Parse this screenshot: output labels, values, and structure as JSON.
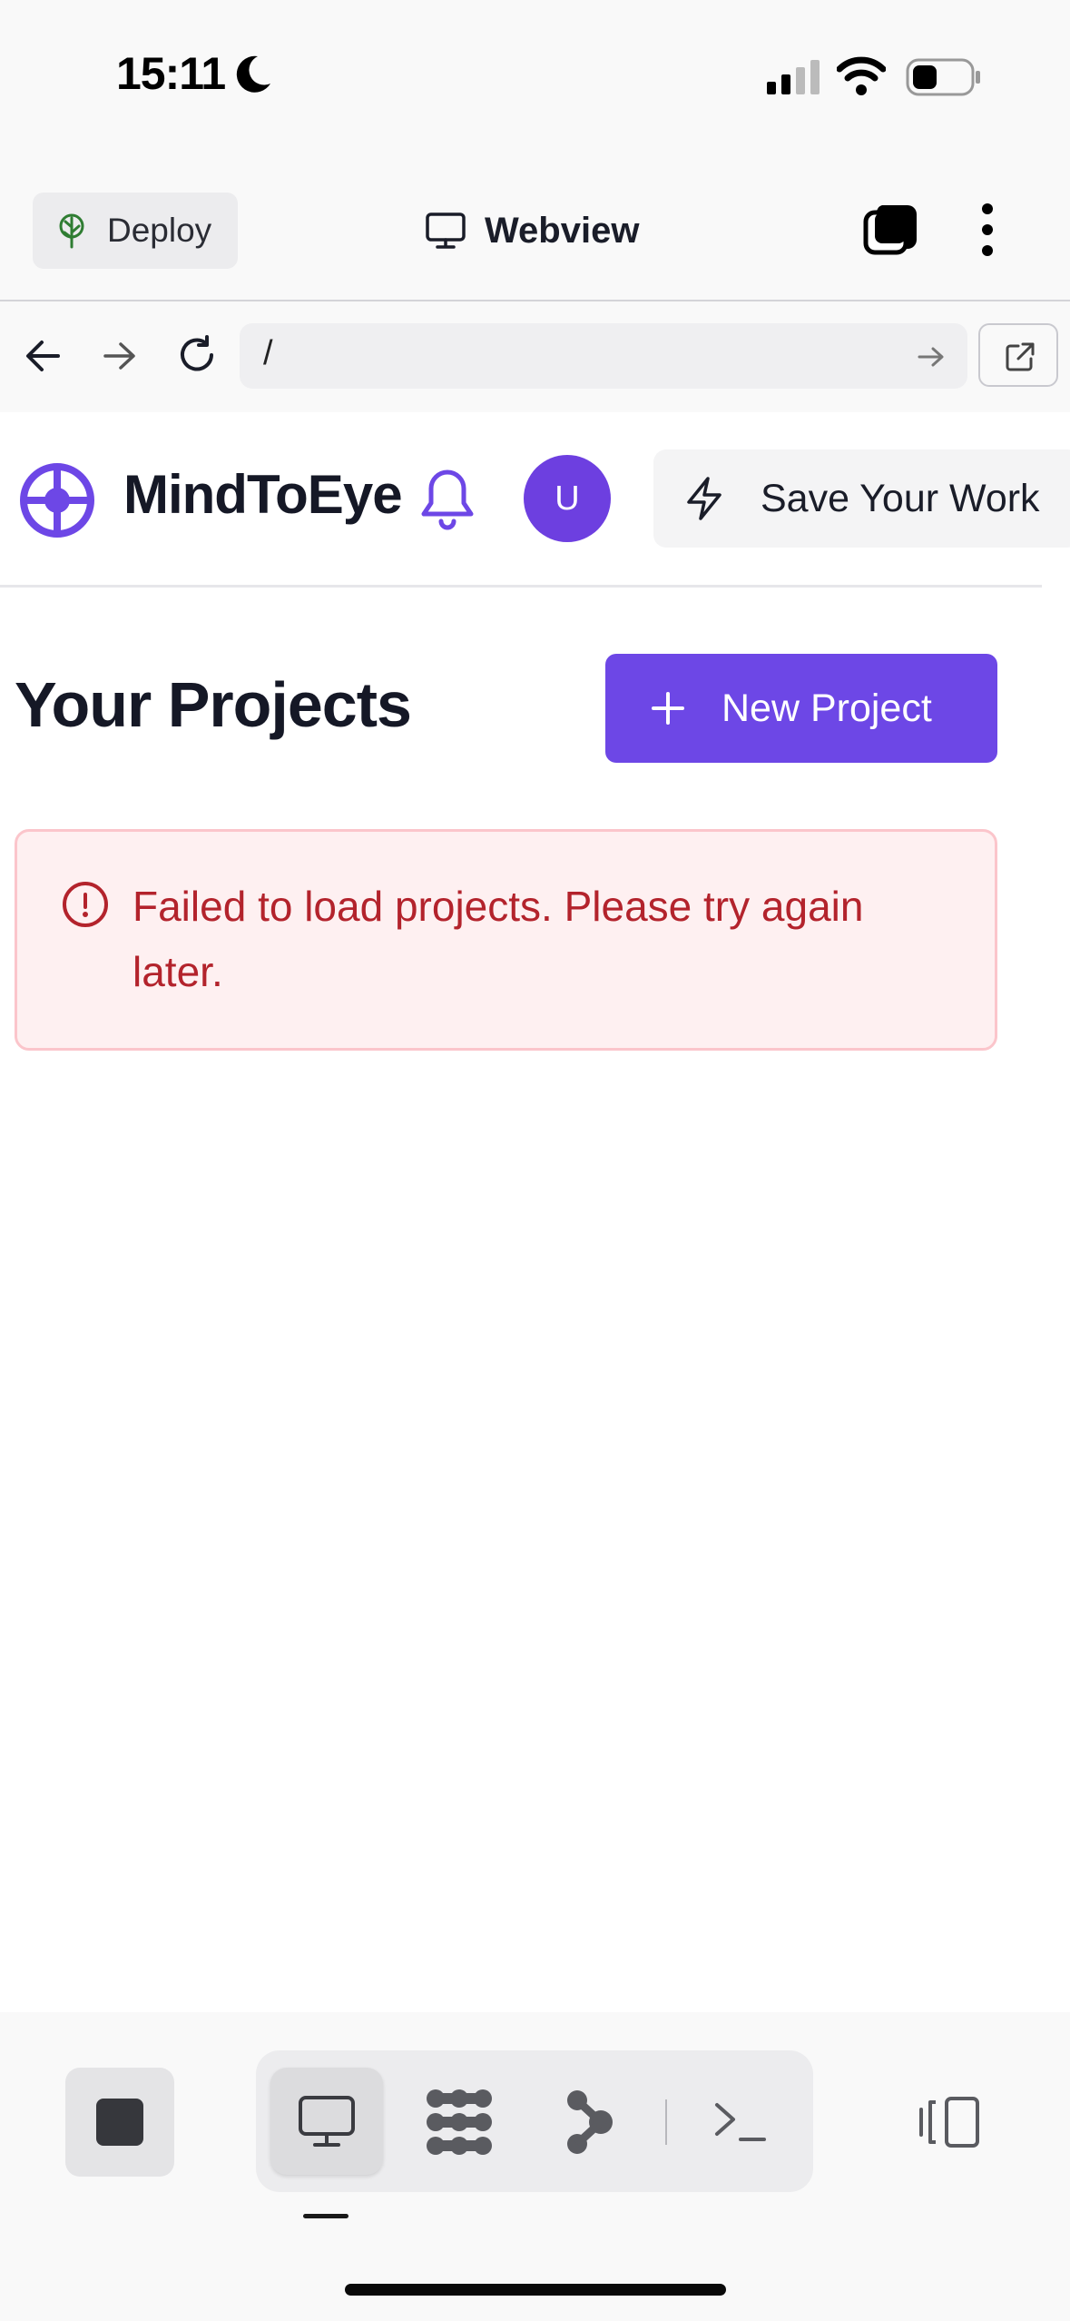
{
  "status_bar": {
    "time": "15:11"
  },
  "top_bar": {
    "deploy_label": "Deploy",
    "title": "Webview"
  },
  "browser": {
    "url": "/"
  },
  "app": {
    "brand": "MindToEye",
    "avatar_initial": "U",
    "save_work_label": "Save Your Work",
    "page_title": "Your Projects",
    "new_project_label": "New Project",
    "error_message": "Failed to load projects. Please try again later."
  },
  "colors": {
    "accent": "#6d47e6",
    "error_text": "#b3232c",
    "error_bg": "#fef0f1"
  },
  "icons": {
    "status": [
      "moon-icon",
      "signal-icon",
      "wifi-icon",
      "battery-icon"
    ],
    "top_bar": [
      "deploy-tree-icon",
      "monitor-icon",
      "tabs-icon",
      "more-vertical-icon"
    ],
    "browser": [
      "back-arrow-icon",
      "forward-arrow-icon",
      "reload-icon",
      "go-arrow-icon",
      "external-link-icon"
    ],
    "app": [
      "logo-crosshair-icon",
      "bell-icon",
      "lightning-icon",
      "plus-icon",
      "info-circle-icon"
    ],
    "toolbar": [
      "stop-icon",
      "monitor-icon",
      "grid-dots-icon",
      "git-branch-icon",
      "terminal-icon",
      "split-panel-icon"
    ]
  }
}
